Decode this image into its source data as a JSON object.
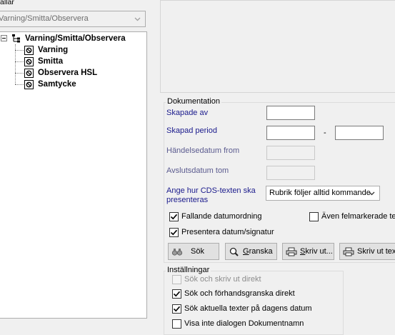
{
  "left": {
    "cut_label": "allar",
    "combo_value": "Varning/Smitta/Observera",
    "tree": {
      "root": "Varning/Smitta/Observera",
      "children": [
        "Varning",
        "Smitta",
        "Observera HSL",
        "Samtycke"
      ]
    }
  },
  "documentation": {
    "group_title": "Dokumentation",
    "created_by_label": "Skapade av",
    "created_period_label": "Skapad period",
    "period_separator": "-",
    "event_date_label": "Händelsedatum from",
    "end_date_label": "Avslutsdatum tom",
    "cds_label_line1": "Ange hur CDS-texten ska",
    "cds_label_line2": "presenteras",
    "cds_select_value": "Rubrik följer alltid kommande",
    "descending_label": "Fallande datumordning",
    "descending_checked": true,
    "also_marked_label": "Även felmarkerade tex",
    "also_marked_checked": false,
    "present_date_label": "Presentera datum/signatur",
    "present_date_checked": true,
    "buttons": {
      "search": "Sök",
      "review_u": "G",
      "review_rest": "ranska",
      "print_u": "S",
      "print_rest": "kriv ut...",
      "print_text": "Skriv ut tex"
    }
  },
  "settings": {
    "group_title": "Inställningar",
    "options": [
      {
        "label": "Sök och skriv ut direkt",
        "checked": false,
        "disabled": true
      },
      {
        "label": "Sök och förhandsgranska direkt",
        "checked": true,
        "disabled": false
      },
      {
        "label": "Sök aktuella texter på dagens datum",
        "checked": true,
        "disabled": false
      },
      {
        "label": "Visa inte dialogen Dokumentnamn",
        "checked": false,
        "disabled": false
      }
    ]
  },
  "colors": {
    "label_blue": "#1a1a8c",
    "panel_bg": "#f0f0f0"
  },
  "icons": {
    "tree_root": "hierarchy-icon",
    "tree_child": "document-seal-icon",
    "search": "binoculars-icon",
    "review": "magnifier-icon",
    "print": "printer-icon"
  }
}
